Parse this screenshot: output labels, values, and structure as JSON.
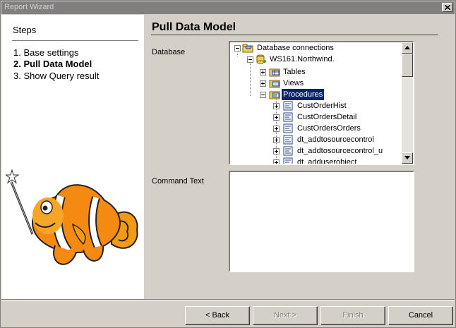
{
  "window": {
    "title": "Report Wizard"
  },
  "steps": {
    "heading": "Steps",
    "items": [
      {
        "label": "1. Base settings",
        "active": false
      },
      {
        "label": "2. Pull Data Model",
        "active": true
      },
      {
        "label": "3. Show Query result",
        "active": false
      }
    ]
  },
  "page": {
    "title": "Pull Data Model",
    "database_label": "Database",
    "command_label": "Command Text",
    "command_text": ""
  },
  "tree": {
    "root": "Database connections",
    "connection": "WS161.Northwind.",
    "tables": "Tables",
    "views": "Views",
    "procedures": "Procedures",
    "procedure_items": [
      "CustOrderHist",
      "CustOrdersDetail",
      "CustOrdersOrders",
      "dt_addtosourcecontrol",
      "dt_addtosourcecontrol_u",
      "dt_adduserobject"
    ]
  },
  "buttons": {
    "back": "< Back",
    "next": "Next >",
    "finish": "Finish",
    "cancel": "Cancel"
  },
  "colors": {
    "selection": "#0a246a",
    "face": "#d4d0c8"
  }
}
